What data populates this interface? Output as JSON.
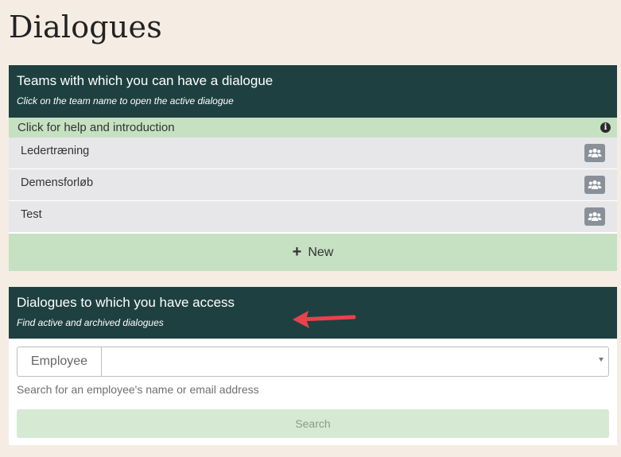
{
  "page": {
    "title": "Dialogues"
  },
  "teams_panel": {
    "title": "Teams with which you can have a dialogue",
    "subtitle": "Click on the team name to open the active dialogue",
    "help_label": "Click for help and introduction",
    "help_icon": "info-icon",
    "teams": [
      {
        "name": "Ledertræning",
        "icon": "team-icon"
      },
      {
        "name": "Demensforløb",
        "icon": "team-icon"
      },
      {
        "name": "Test",
        "icon": "team-icon"
      }
    ],
    "new_label": "New"
  },
  "dialogues_panel": {
    "title": "Dialogues to which you have access",
    "subtitle": "Find active and archived dialogues",
    "employee_label": "Employee",
    "employee_value": "",
    "help_text": "Search for an employee's name or email address",
    "search_label": "Search"
  },
  "colors": {
    "background": "#f5ede3",
    "header": "#1f4040",
    "accent_green": "#c5e1c1",
    "annotation_arrow": "#e8424a"
  }
}
